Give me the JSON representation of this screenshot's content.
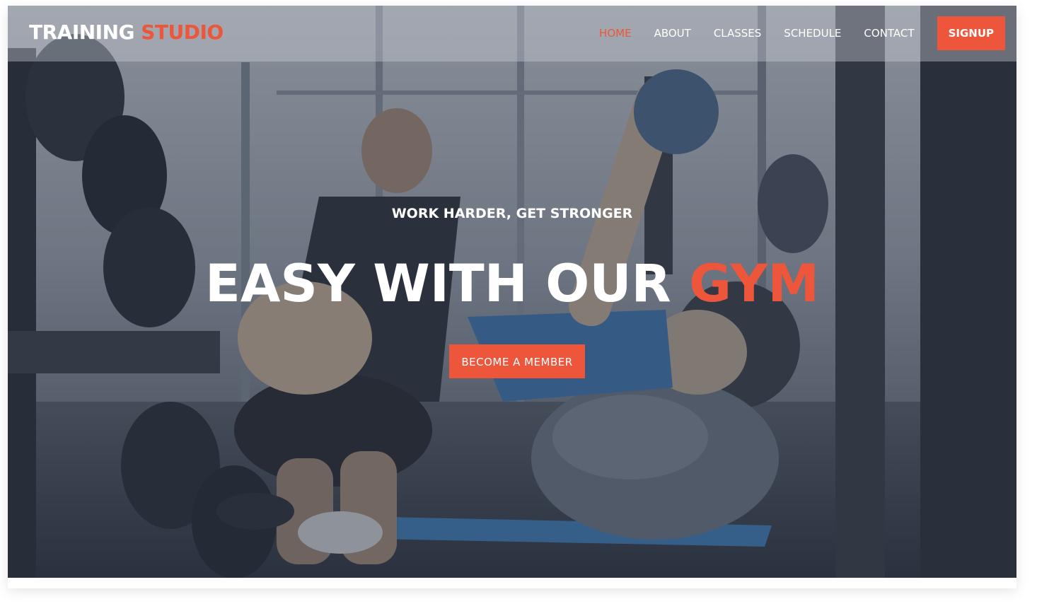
{
  "brand": {
    "name_white": "TRAINING",
    "name_orange": "STUDIO"
  },
  "nav": {
    "items": [
      {
        "label": "HOME",
        "active": true
      },
      {
        "label": "ABOUT"
      },
      {
        "label": "CLASSES"
      },
      {
        "label": "SCHEDULE"
      },
      {
        "label": "CONTACT"
      }
    ],
    "signup_label": "SIGNUP"
  },
  "hero": {
    "tagline": "WORK HARDER, GET STRONGER",
    "headline_white": "EASY WITH OUR",
    "headline_orange": "GYM",
    "cta_label": "BECOME A MEMBER",
    "background": "gym-workout-photo"
  },
  "colors": {
    "accent": "#ed563b",
    "text": "#ffffff",
    "overlay": "#252c3c"
  }
}
